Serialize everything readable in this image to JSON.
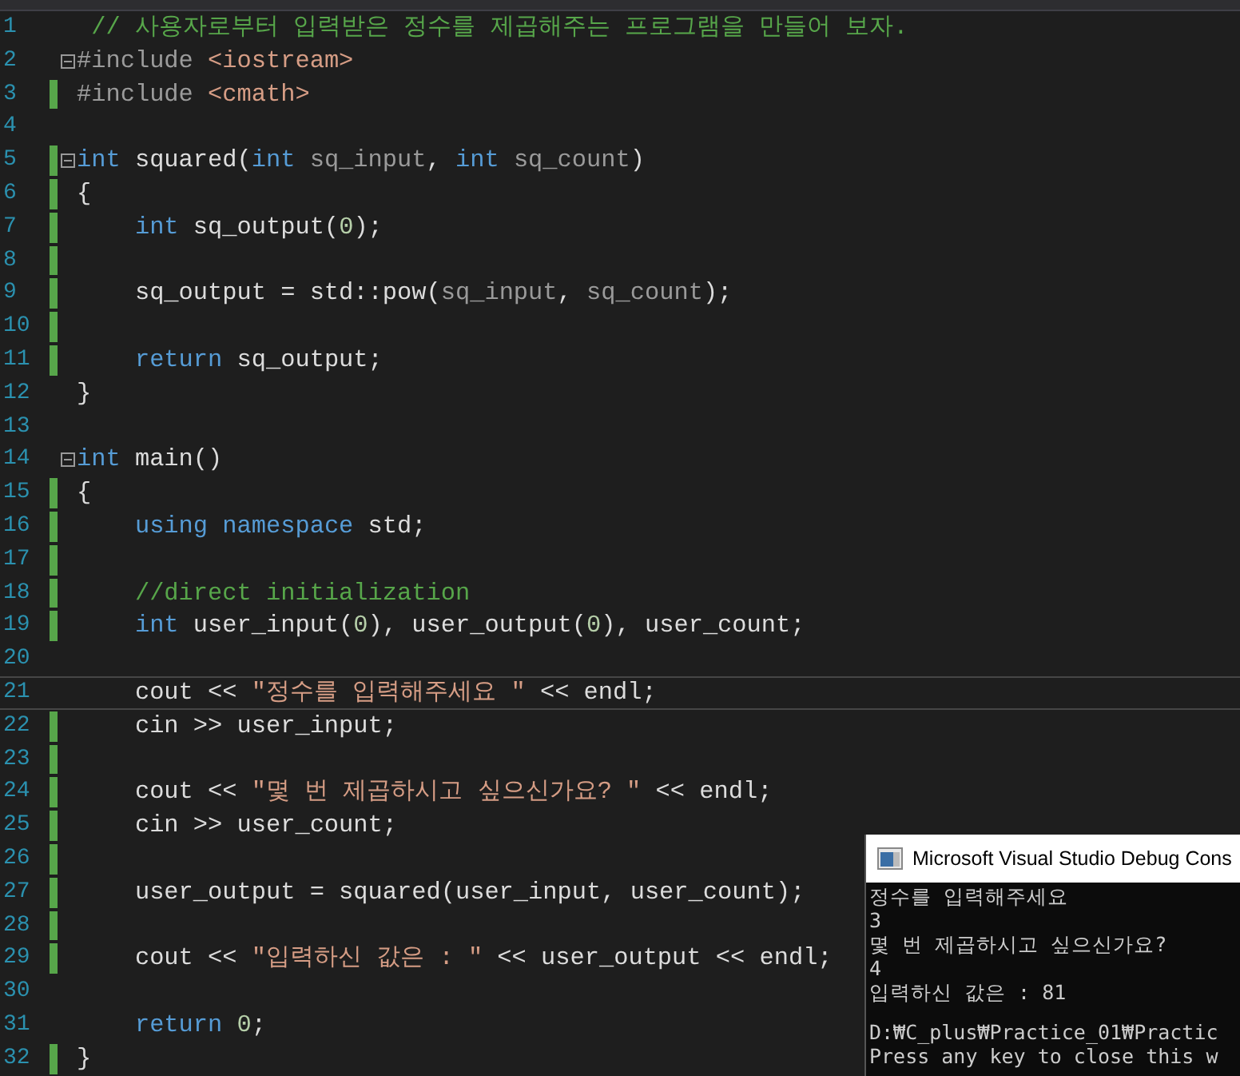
{
  "editor": {
    "lines": [
      {
        "number": "1",
        "changed": false,
        "fold": false,
        "current": false,
        "indented": false,
        "tokens": [
          {
            "kind": "comment",
            "text": " // 사용자로부터 입력받은 정수를 제곱해주는 프로그램을 만들어 보자."
          }
        ]
      },
      {
        "number": "2",
        "changed": false,
        "fold": true,
        "current": false,
        "indented": false,
        "tokens": [
          {
            "kind": "preproc",
            "text": "#include"
          },
          {
            "kind": "string",
            "text": " <iostream>"
          }
        ]
      },
      {
        "number": "3",
        "changed": true,
        "fold": false,
        "current": false,
        "indented": false,
        "tokens": [
          {
            "kind": "preproc",
            "text": "#include"
          },
          {
            "kind": "string",
            "text": " <cmath>"
          }
        ]
      },
      {
        "number": "4",
        "changed": false,
        "fold": false,
        "current": false
      },
      {
        "number": "5",
        "changed": true,
        "fold": true,
        "current": false,
        "indented": false,
        "tokens": [
          {
            "kind": "keyword",
            "text": "int"
          },
          {
            "kind": "plain",
            "text": " squared("
          },
          {
            "kind": "keyword",
            "text": "int"
          },
          {
            "kind": "param",
            "text": " sq_input"
          },
          {
            "kind": "plain",
            "text": ", "
          },
          {
            "kind": "keyword",
            "text": "int"
          },
          {
            "kind": "param",
            "text": " sq_count"
          },
          {
            "kind": "plain",
            "text": ")"
          }
        ]
      },
      {
        "number": "6",
        "changed": true,
        "fold": false,
        "current": false,
        "indented": false,
        "tokens": [
          {
            "kind": "plain",
            "text": "{"
          }
        ]
      },
      {
        "number": "7",
        "changed": true,
        "fold": false,
        "current": false,
        "indented": true,
        "tokens": [
          {
            "kind": "keyword",
            "text": "int"
          },
          {
            "kind": "plain",
            "text": " sq_output("
          },
          {
            "kind": "number",
            "text": "0"
          },
          {
            "kind": "plain",
            "text": ");"
          }
        ]
      },
      {
        "number": "8",
        "changed": true,
        "fold": false,
        "current": false
      },
      {
        "number": "9",
        "changed": true,
        "fold": false,
        "current": false,
        "indented": true,
        "tokens": [
          {
            "kind": "plain",
            "text": "sq_output = std::pow("
          },
          {
            "kind": "param",
            "text": "sq_input"
          },
          {
            "kind": "plain",
            "text": ", "
          },
          {
            "kind": "param",
            "text": "sq_count"
          },
          {
            "kind": "plain",
            "text": ");"
          }
        ]
      },
      {
        "number": "10",
        "changed": true,
        "fold": false,
        "current": false
      },
      {
        "number": "11",
        "changed": true,
        "fold": false,
        "current": false,
        "indented": true,
        "tokens": [
          {
            "kind": "keyword",
            "text": "return"
          },
          {
            "kind": "plain",
            "text": " sq_output;"
          }
        ]
      },
      {
        "number": "12",
        "changed": false,
        "fold": false,
        "current": false,
        "tokens": [
          {
            "kind": "plain",
            "text": "}"
          }
        ]
      },
      {
        "number": "13",
        "changed": false,
        "fold": false,
        "current": false
      },
      {
        "number": "14",
        "changed": false,
        "fold": true,
        "current": false,
        "indented": false,
        "tokens": [
          {
            "kind": "keyword",
            "text": "int"
          },
          {
            "kind": "plain",
            "text": " main()"
          }
        ]
      },
      {
        "number": "15",
        "changed": true,
        "fold": false,
        "current": false,
        "indented": false,
        "tokens": [
          {
            "kind": "plain",
            "text": "{"
          }
        ]
      },
      {
        "number": "16",
        "changed": true,
        "fold": false,
        "current": false,
        "indented": true,
        "tokens": [
          {
            "kind": "keyword",
            "text": "using"
          },
          {
            "kind": "keyword",
            "text": " namespace"
          },
          {
            "kind": "plain",
            "text": " std;"
          }
        ]
      },
      {
        "number": "17",
        "changed": true,
        "fold": false,
        "current": false
      },
      {
        "number": "18",
        "changed": true,
        "fold": false,
        "current": false,
        "indented": true,
        "tokens": [
          {
            "kind": "comment",
            "text": "//direct initialization"
          }
        ]
      },
      {
        "number": "19",
        "changed": true,
        "fold": false,
        "current": false,
        "indented": true,
        "tokens": [
          {
            "kind": "keyword",
            "text": "int"
          },
          {
            "kind": "plain",
            "text": " user_input("
          },
          {
            "kind": "number",
            "text": "0"
          },
          {
            "kind": "plain",
            "text": "), user_output("
          },
          {
            "kind": "number",
            "text": "0"
          },
          {
            "kind": "plain",
            "text": "), user_count;"
          }
        ]
      },
      {
        "number": "20",
        "changed": false,
        "fold": false,
        "current": false
      },
      {
        "number": "21",
        "changed": false,
        "fold": false,
        "current": true,
        "indented": true,
        "tokens": [
          {
            "kind": "plain",
            "text": "cout << "
          },
          {
            "kind": "string",
            "text": "\"정수를 입력해주세요 \""
          },
          {
            "kind": "plain",
            "text": " << endl;"
          }
        ]
      },
      {
        "number": "22",
        "changed": true,
        "fold": false,
        "current": false,
        "indented": true,
        "tokens": [
          {
            "kind": "plain",
            "text": "cin >> user_input;"
          }
        ]
      },
      {
        "number": "23",
        "changed": true,
        "fold": false,
        "current": false
      },
      {
        "number": "24",
        "changed": true,
        "fold": false,
        "current": false,
        "indented": true,
        "tokens": [
          {
            "kind": "plain",
            "text": "cout << "
          },
          {
            "kind": "string",
            "text": "\"몇 번 제곱하시고 싶으신가요? \""
          },
          {
            "kind": "plain",
            "text": " << endl;"
          }
        ]
      },
      {
        "number": "25",
        "changed": true,
        "fold": false,
        "current": false,
        "indented": true,
        "tokens": [
          {
            "kind": "plain",
            "text": "cin >> user_count;"
          }
        ]
      },
      {
        "number": "26",
        "changed": true,
        "fold": false,
        "current": false
      },
      {
        "number": "27",
        "changed": true,
        "fold": false,
        "current": false,
        "indented": true,
        "tokens": [
          {
            "kind": "plain",
            "text": "user_output = squared(user_input, user_count);"
          }
        ]
      },
      {
        "number": "28",
        "changed": true,
        "fold": false,
        "current": false
      },
      {
        "number": "29",
        "changed": true,
        "fold": false,
        "current": false,
        "indented": true,
        "tokens": [
          {
            "kind": "plain",
            "text": "cout << "
          },
          {
            "kind": "string",
            "text": "\"입력하신 값은 : \""
          },
          {
            "kind": "plain",
            "text": " << user_output << endl;"
          }
        ]
      },
      {
        "number": "30",
        "changed": false,
        "fold": false,
        "current": false
      },
      {
        "number": "31",
        "changed": false,
        "fold": false,
        "current": false,
        "indented": true,
        "tokens": [
          {
            "kind": "keyword",
            "text": "return"
          },
          {
            "kind": "number",
            "text": " 0"
          },
          {
            "kind": "plain",
            "text": ";"
          }
        ]
      },
      {
        "number": "32",
        "changed": true,
        "fold": false,
        "current": false,
        "indented": false,
        "tokens": [
          {
            "kind": "plain",
            "text": "}"
          }
        ]
      }
    ]
  },
  "console": {
    "title": "Microsoft Visual Studio Debug Cons",
    "lines": [
      "정수를 입력해주세요",
      "3",
      "몇 번 제곱하시고 싶으신가요?",
      "4",
      "입력하신 값은 : 81",
      "D:₩C_plus₩Practice_01₩Practic",
      "Press any key to close this w"
    ]
  }
}
